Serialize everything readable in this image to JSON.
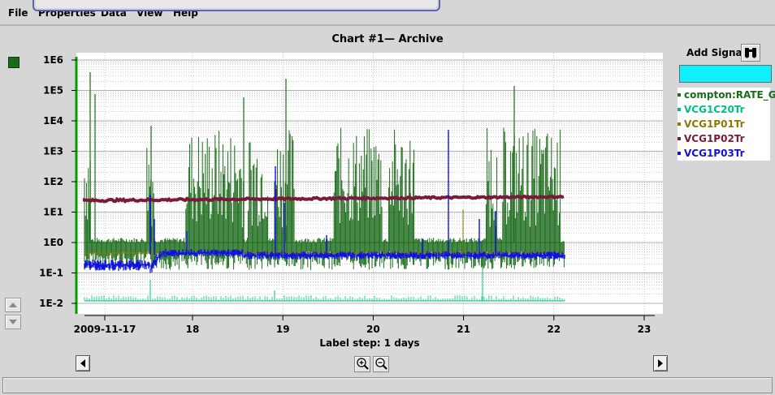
{
  "menu": [
    "File",
    "Properties",
    "Data",
    "View",
    "Help"
  ],
  "chart_title": "Chart #1— Archive",
  "add_signal_label": "Add Signal",
  "add_signal_value": "",
  "icons": {
    "add_signal": "binoculars-icon",
    "scroll_up": "triangle-up-icon",
    "scroll_down": "triangle-down-icon",
    "pan_left": "triangle-left-icon",
    "pan_right": "triangle-right-icon",
    "zoom_in": "zoom-in-icon",
    "zoom_out": "zoom-out-icon"
  },
  "colors": {
    "signal_input_bg": "#00f0ff",
    "chart_bg": "#ffffff",
    "grid": "#999999",
    "y_axis": "#00a000"
  },
  "chart_data": {
    "type": "line",
    "title": "Chart #1— Archive",
    "xlabel": "Label step: 1 days",
    "ylabel": "",
    "y_scale": "log",
    "ylim": [
      0.01,
      1000000
    ],
    "y_tick_labels": [
      "1E-2",
      "1E-1",
      "1E0",
      "1E1",
      "1E2",
      "1E3",
      "1E4",
      "1E5",
      "1E6"
    ],
    "xlim": [
      "2009-11-17",
      "2009-11-23"
    ],
    "x_tick_labels": [
      "2009-11-17",
      "18",
      "19",
      "20",
      "21",
      "22",
      "23"
    ],
    "grid": true,
    "legend_position": "right",
    "series": [
      {
        "name": "compton:RATE_G",
        "color": "#1a6b1a",
        "x_days": [
          0.0,
          0.5,
          1.0,
          1.5,
          2.0,
          2.5,
          3.0,
          3.5,
          4.0,
          4.5,
          5.0
        ],
        "values": [
          1.0,
          1.0,
          1.0,
          30,
          200,
          1.0,
          1.0,
          1.0,
          1.0,
          150,
          1.0
        ]
      },
      {
        "name": "VCG1C20Tr",
        "color": "#00c080",
        "x_days": [
          0.0,
          1.0,
          2.0,
          3.0,
          4.0,
          5.0
        ],
        "values": [
          0.012,
          0.012,
          0.012,
          0.012,
          0.012,
          0.012
        ]
      },
      {
        "name": "VCG1P01Tr",
        "color": "#8a7a00",
        "x_days": [
          0.0,
          1.0,
          2.0,
          3.0,
          4.0,
          5.0
        ],
        "values": [
          0.45,
          0.45,
          0.45,
          0.45,
          0.45,
          0.45
        ]
      },
      {
        "name": "VCG1P02Tr",
        "color": "#7a1a3a",
        "x_days": [
          0.0,
          1.0,
          2.0,
          3.0,
          4.0,
          5.0
        ],
        "values": [
          22,
          24,
          26,
          27,
          26,
          28
        ]
      },
      {
        "name": "VCG1P03Tr",
        "color": "#1010e0",
        "x_days": [
          0.0,
          0.5,
          0.8,
          1.0,
          2.0,
          3.0,
          4.0,
          5.0
        ],
        "values": [
          0.18,
          0.18,
          0.45,
          0.45,
          0.38,
          0.38,
          0.42,
          0.38
        ]
      }
    ]
  }
}
